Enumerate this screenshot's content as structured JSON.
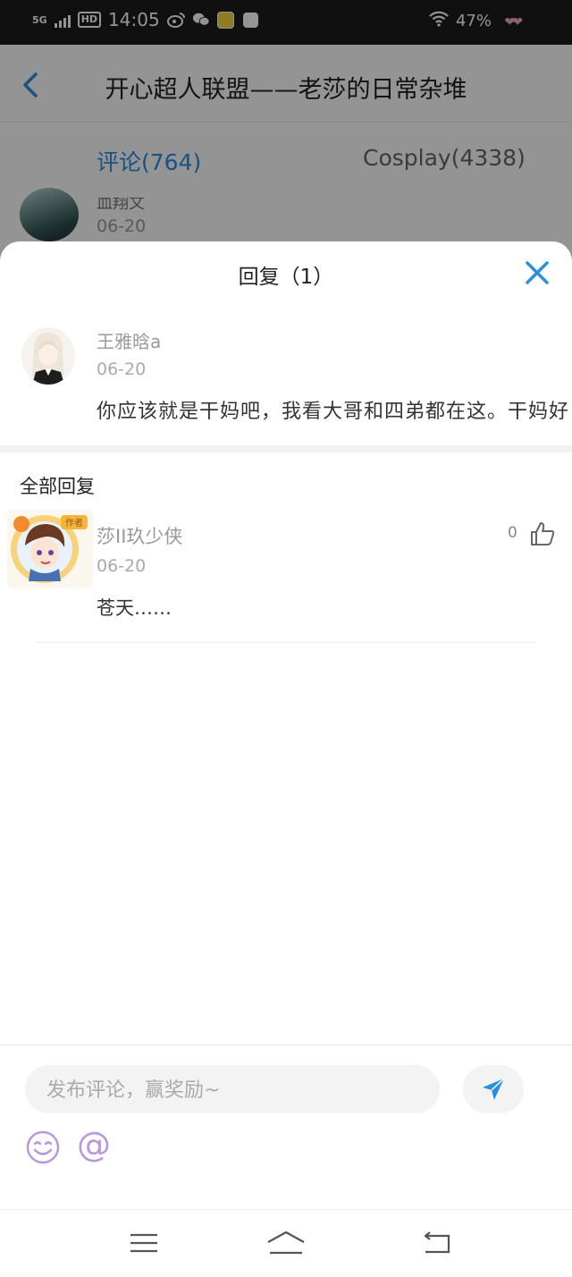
{
  "status_bar": {
    "network": "5G",
    "hd": "HD",
    "time": "14:05",
    "battery": "47%"
  },
  "background_page": {
    "title": "开心超人联盟——老莎的日常杂堆",
    "tabs": [
      {
        "label": "评论(764)",
        "active": true
      },
      {
        "label": "Cosplay(4338)",
        "active": false
      }
    ],
    "peek_comment": {
      "name": "血翔文",
      "date": "06-20"
    }
  },
  "sheet": {
    "title": "回复（1）",
    "main_comment": {
      "author": "王雅晗a",
      "date": "06-20",
      "text": "你应该就是干妈吧，我看大哥和四弟都在这。干妈好"
    },
    "section_label": "全部回复",
    "replies": [
      {
        "author": "莎II玖少侠",
        "date": "06-20",
        "text": "苍天……",
        "likes": "0",
        "badge": "作者"
      }
    ]
  },
  "composer": {
    "placeholder": "发布评论，赢奖励~",
    "at_symbol": "@"
  },
  "colors": {
    "accent": "#2a8fe0",
    "emoji_purple": "#b898e0"
  }
}
